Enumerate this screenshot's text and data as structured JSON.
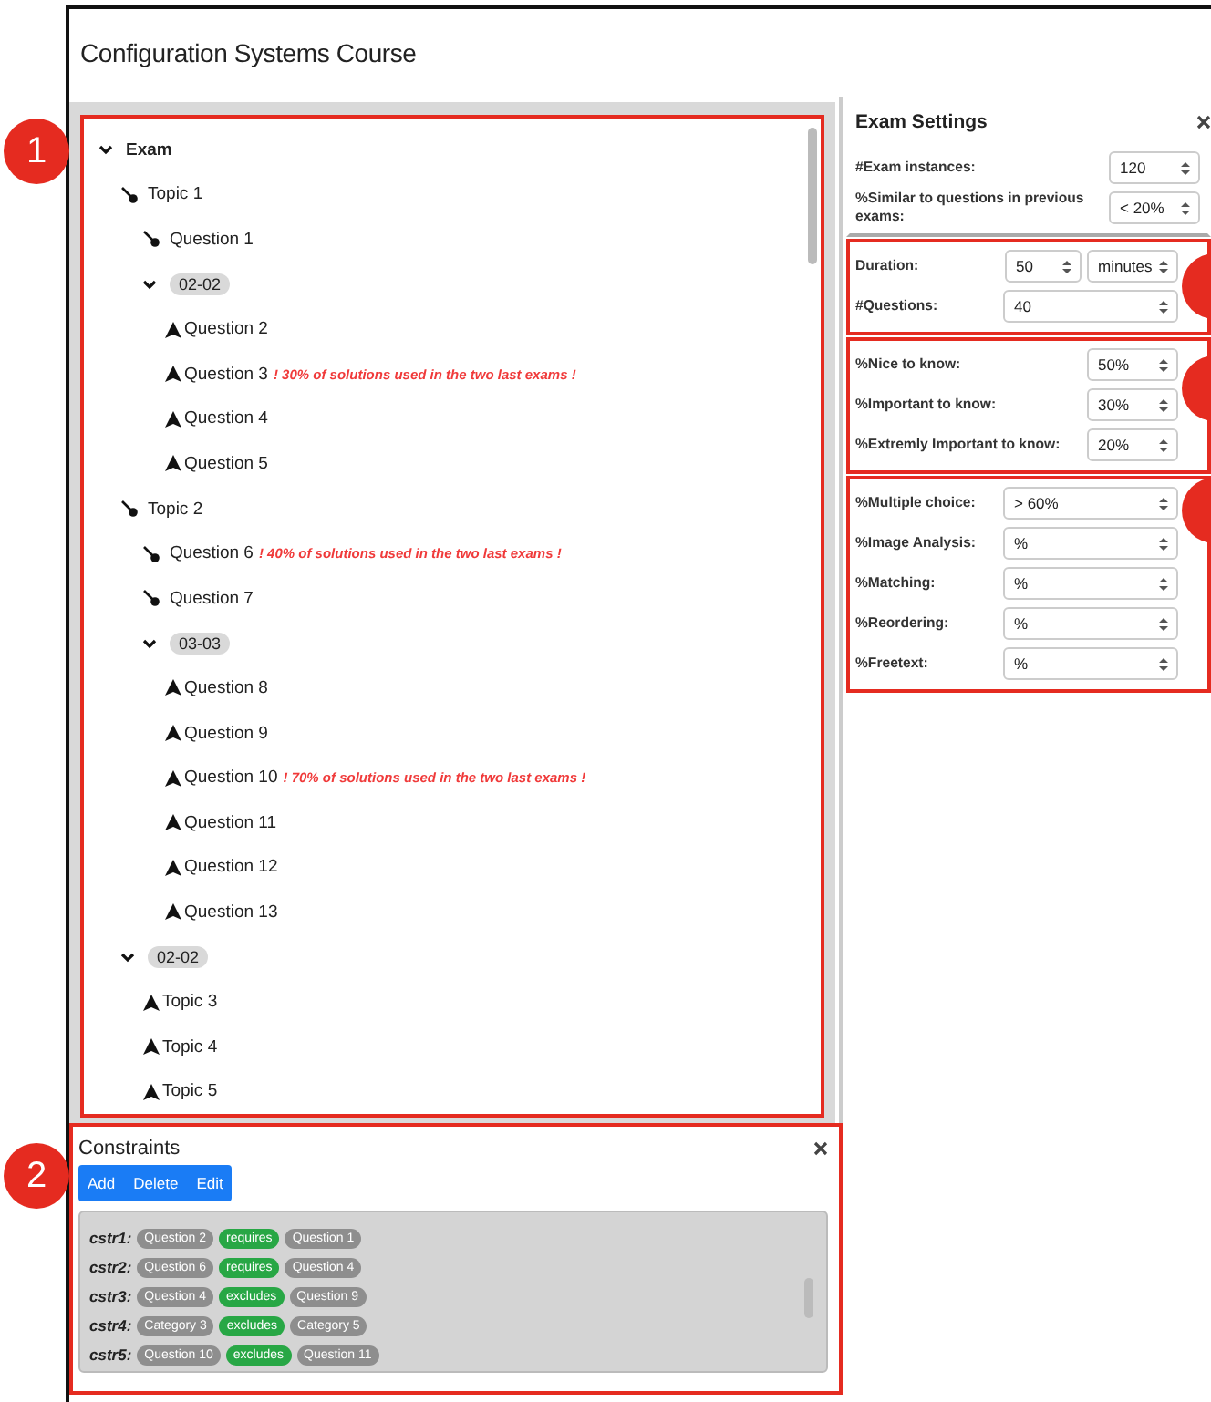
{
  "title": "Configuration Systems Course",
  "callouts": [
    "1",
    "2"
  ],
  "tree": [
    {
      "kind": "branch",
      "label": "Exam",
      "expanded": true,
      "children": [
        {
          "kind": "pin",
          "label": "Topic 1",
          "children": [
            {
              "kind": "pin",
              "label": "Question 1"
            },
            {
              "kind": "tag",
              "label": "02-02",
              "expanded": true,
              "children": [
                {
                  "kind": "triangle",
                  "label": "Question 2"
                },
                {
                  "kind": "triangle",
                  "label": "Question 3",
                  "warning": "! 30% of solutions used in the two last exams !"
                },
                {
                  "kind": "triangle",
                  "label": "Question 4"
                },
                {
                  "kind": "triangle",
                  "label": "Question 5"
                }
              ]
            }
          ]
        },
        {
          "kind": "pin",
          "label": "Topic 2",
          "children": [
            {
              "kind": "pin",
              "label": "Question 6",
              "warning": "! 40% of solutions used in the two last exams !"
            },
            {
              "kind": "pin",
              "label": "Question 7"
            },
            {
              "kind": "tag",
              "label": "03-03",
              "expanded": true,
              "children": [
                {
                  "kind": "triangle",
                  "label": "Question 8"
                },
                {
                  "kind": "triangle",
                  "label": "Question 9"
                },
                {
                  "kind": "triangle",
                  "label": "Question 10",
                  "warning": "! 70% of solutions used in the two last exams !"
                },
                {
                  "kind": "triangle",
                  "label": "Question 11"
                },
                {
                  "kind": "triangle",
                  "label": "Question 12"
                },
                {
                  "kind": "triangle",
                  "label": "Question 13"
                }
              ]
            }
          ]
        },
        {
          "kind": "tag",
          "label": "02-02",
          "expanded": true,
          "children": [
            {
              "kind": "triangle",
              "label": "Topic 3"
            },
            {
              "kind": "triangle",
              "label": "Topic 4"
            },
            {
              "kind": "triangle",
              "label": "Topic 5"
            }
          ]
        }
      ]
    }
  ],
  "constraints": {
    "title": "Constraints",
    "buttons": [
      "Add",
      "Delete",
      "Edit"
    ],
    "rows": [
      {
        "name": "cstr1:",
        "left": "Question 2",
        "relation": "requires",
        "right": "Question 1"
      },
      {
        "name": "cstr2:",
        "left": "Question 6",
        "relation": "requires",
        "right": "Question 4"
      },
      {
        "name": "cstr3:",
        "left": "Question 4",
        "relation": "excludes",
        "right": "Question 9"
      },
      {
        "name": "cstr4:",
        "left": "Category 3",
        "relation": "excludes",
        "right": "Category 5"
      },
      {
        "name": "cstr5:",
        "left": "Question 10",
        "relation": "excludes",
        "right": "Question 11"
      }
    ]
  },
  "settings": {
    "title": "Exam Settings",
    "groups": [
      {
        "highlighted": false,
        "fields": [
          {
            "label": "#Exam instances:",
            "value": "120"
          },
          {
            "label": "%Similar to questions in previous exams:",
            "value": "< 20%"
          }
        ]
      },
      {
        "highlighted": true,
        "fields": [
          {
            "label": "Duration:",
            "value": "50",
            "unit": "minutes"
          },
          {
            "label": "#Questions:",
            "value": "40"
          }
        ]
      },
      {
        "highlighted": true,
        "fields": [
          {
            "label": "%Nice to know:",
            "value": "50%"
          },
          {
            "label": "%Important to know:",
            "value": "30%"
          },
          {
            "label": "%Extremly Important to know:",
            "value": "20%"
          }
        ]
      },
      {
        "highlighted": true,
        "fields": [
          {
            "label": "%Multiple choice:",
            "value": "> 60%"
          },
          {
            "label": "%Image Analysis:",
            "value": "%"
          },
          {
            "label": "%Matching:",
            "value": "%"
          },
          {
            "label": "%Reordering:",
            "value": "%"
          },
          {
            "label": "%Freetext:",
            "value": "%"
          }
        ]
      }
    ]
  }
}
